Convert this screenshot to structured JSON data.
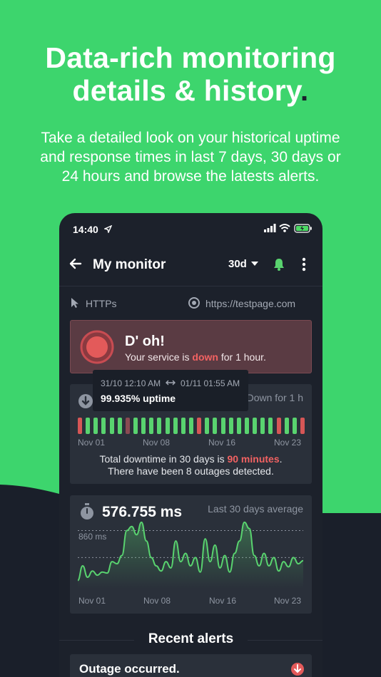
{
  "colors": {
    "background": "#3dd56d",
    "phone": "#1c212b",
    "card": "#2a303a",
    "accent_green": "#59d36f",
    "alert_red": "#f26262",
    "alert_bg": "#5a3b43"
  },
  "headline": {
    "line1": "Data-rich monitoring",
    "line2": "details & history",
    "dot": "."
  },
  "subline": {
    "line1": "Take a detailed look on your historical uptime",
    "line2": "and response times in last 7 days, 30 days or",
    "line3": "24 hours and browse the latests alerts."
  },
  "status_bar": {
    "time": "14:40",
    "icons": [
      "location-arrow-icon",
      "signal-icon",
      "wifi-icon",
      "battery-icon"
    ]
  },
  "appbar": {
    "title": "My monitor",
    "range": "30d",
    "icons": [
      "back-arrow-icon",
      "chevron-down-icon",
      "bell-icon",
      "more-vertical-icon"
    ]
  },
  "monitor": {
    "protocol": "HTTPs",
    "url": "https://testpage.com"
  },
  "alert": {
    "title": "D' oh!",
    "message_pre": "Your service is ",
    "message_status": "down",
    "message_post": " for 1 hour."
  },
  "tooltip": {
    "start": "31/10 12:10 AM",
    "end": "01/11 01:55 AM",
    "uptime": "99.935% uptime"
  },
  "uptime": {
    "down_for": "Down for 1 h",
    "bars": [
      "down",
      "up",
      "up",
      "up",
      "up",
      "up",
      "down",
      "up",
      "up",
      "up",
      "up",
      "up",
      "up",
      "up",
      "up",
      "down",
      "up",
      "up",
      "up",
      "up",
      "up",
      "up",
      "up",
      "up",
      "up",
      "down",
      "up",
      "up",
      "down"
    ],
    "xticks": [
      "Nov 01",
      "Nov 08",
      "Nov 16",
      "Nov 23"
    ],
    "summary_pre": "Total downtime in 30 days is ",
    "summary_value": "90 minutes",
    "summary_post": ".",
    "summary_line2": "There have been 8 outages detected."
  },
  "response": {
    "average": "576.755 ms",
    "average_label": "Last 30 days average",
    "y_label": "860 ms"
  },
  "chart_data": {
    "type": "area",
    "title": "576.755 ms",
    "ylabel": "",
    "x": [
      "Nov 01",
      "Nov 08",
      "Nov 16",
      "Nov 23"
    ],
    "series": [
      {
        "values": [
          380,
          520,
          410,
          470,
          430,
          460,
          450,
          560,
          540,
          620,
          860,
          900,
          820,
          940,
          760,
          600,
          520,
          470,
          560,
          500,
          760,
          560,
          640,
          520,
          600,
          460,
          780,
          560,
          720,
          500,
          620,
          460,
          640,
          760,
          940,
          880,
          620,
          520,
          640,
          520,
          600,
          470,
          560,
          510,
          600,
          540,
          570
        ]
      }
    ],
    "reference_lines": [
      860,
      600
    ],
    "grid": false,
    "ylim": [
      300,
      960
    ]
  },
  "recent_alerts": {
    "title": "Recent alerts",
    "items": [
      {
        "title": "Outage occurred.",
        "icon": "down-circle-icon"
      }
    ]
  }
}
